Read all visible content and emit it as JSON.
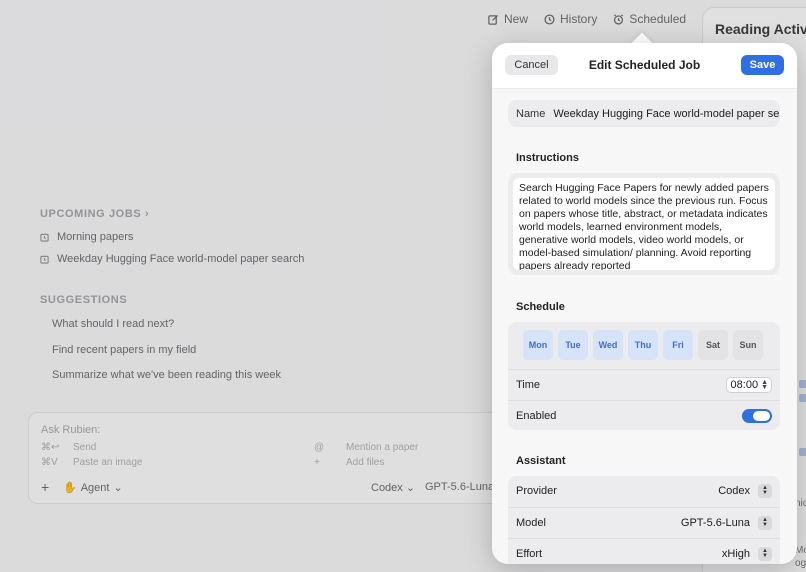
{
  "toolbar": {
    "new_label": "New",
    "history_label": "History",
    "scheduled_label": "Scheduled"
  },
  "side_panel": {
    "title": "Reading Activity",
    "fragments": [
      "nic",
      "Mc",
      "ogy"
    ]
  },
  "upcoming": {
    "title": "UPCOMING JOBS",
    "jobs": [
      "Morning papers",
      "Weekday Hugging Face world-model paper search"
    ]
  },
  "suggestions": {
    "title": "SUGGESTIONS",
    "items": [
      "What should I read next?",
      "Find recent papers in my field",
      "Summarize what we've been reading this week"
    ]
  },
  "composer": {
    "placeholder": "Ask Rubien:",
    "hints": [
      {
        "key": "⌘↩",
        "label": "Send"
      },
      {
        "key": "⌘V",
        "label": "Paste an image"
      },
      {
        "key": "@",
        "label": "Mention a paper"
      },
      {
        "key": "+",
        "label": "Add files"
      }
    ],
    "plus": "+",
    "agent_label": "Agent",
    "provider": "Codex",
    "model": "GPT-5.6-Luna"
  },
  "dialog": {
    "title": "Edit Scheduled Job",
    "cancel_label": "Cancel",
    "save_label": "Save",
    "name_label": "Name",
    "name_value": "Weekday Hugging Face world-model paper search",
    "instructions_heading": "Instructions",
    "instructions_text": "Search Hugging Face Papers for newly added papers related to world models since the previous run. Focus on papers whose title, abstract, or metadata indicates world models, learned environment models, generative world models, video world models, or model-based simulation/ planning. Avoid reporting papers already reported",
    "schedule_heading": "Schedule",
    "days": [
      {
        "label": "Mon",
        "on": true
      },
      {
        "label": "Tue",
        "on": true
      },
      {
        "label": "Wed",
        "on": true
      },
      {
        "label": "Thu",
        "on": true
      },
      {
        "label": "Fri",
        "on": true
      },
      {
        "label": "Sat",
        "on": false
      },
      {
        "label": "Sun",
        "on": false
      }
    ],
    "time_label": "Time",
    "time_value": "08:00",
    "enabled_label": "Enabled",
    "enabled": true,
    "assistant_heading": "Assistant",
    "provider_label": "Provider",
    "provider_value": "Codex",
    "model_label": "Model",
    "model_value": "GPT-5.6-Luna",
    "effort_label": "Effort",
    "effort_value": "xHigh"
  },
  "colors": {
    "accent": "#2f6fe4",
    "day_on_bg": "#d7e3f8",
    "day_on_text": "#3f6fc7"
  }
}
